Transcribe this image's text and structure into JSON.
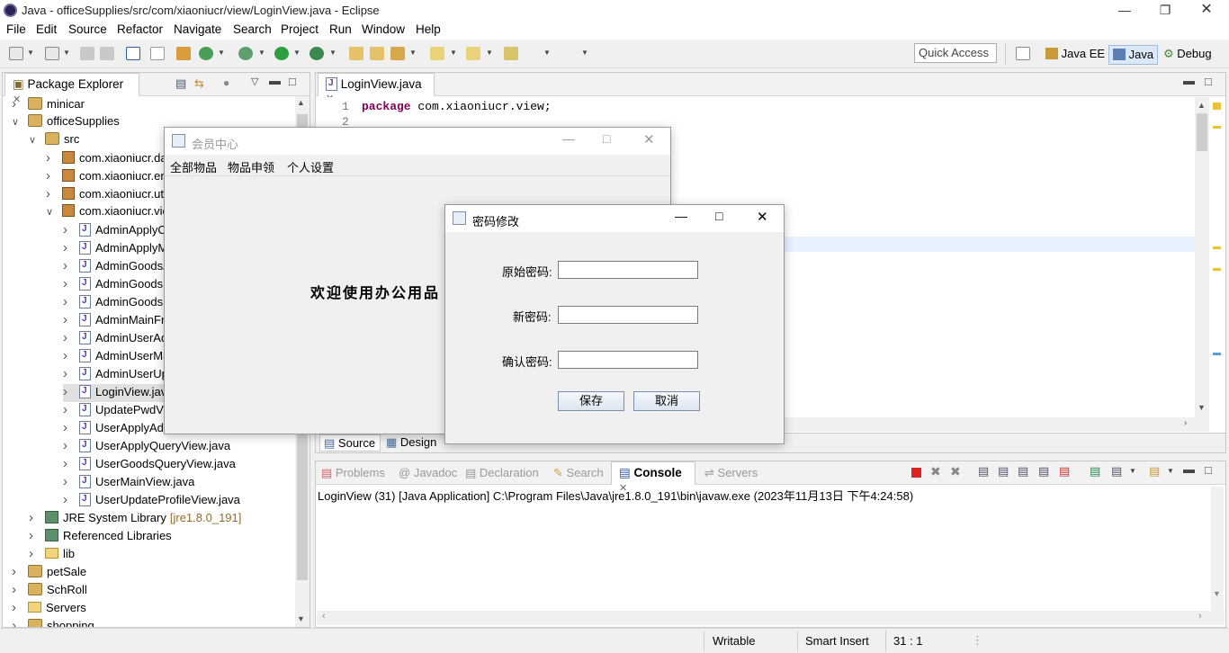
{
  "window": {
    "title": "Java - officeSupplies/src/com/xiaoniucr/view/LoginView.java - Eclipse"
  },
  "menubar": [
    "File",
    "Edit",
    "Source",
    "Refactor",
    "Navigate",
    "Search",
    "Project",
    "Run",
    "Window",
    "Help"
  ],
  "toolbar": {
    "quick_access": "Quick Access",
    "perspectives": [
      "Java EE",
      "Java",
      "Debug"
    ]
  },
  "package_explorer": {
    "tab_label": "Package Explorer",
    "rows": [
      {
        "label": "minicar",
        "icon": "project-icon",
        "arrow": ">"
      },
      {
        "label": "officeSupplies",
        "icon": "project-icon",
        "arrow": "v"
      },
      {
        "label": "src",
        "icon": "src-folder-icon",
        "arrow": "v"
      },
      {
        "label": "com.xiaoniucr.dao",
        "icon": "package-icon",
        "arrow": ">"
      },
      {
        "label": "com.xiaoniucr.entity",
        "icon": "package-icon",
        "arrow": ">"
      },
      {
        "label": "com.xiaoniucr.util",
        "icon": "package-icon",
        "arrow": ">"
      },
      {
        "label": "com.xiaoniucr.view",
        "icon": "package-icon",
        "arrow": "v"
      },
      {
        "label": "AdminApplyCheckView.java",
        "icon": "java-file-icon",
        "arrow": ">"
      },
      {
        "label": "AdminApplyManageView.java",
        "icon": "java-file-icon",
        "arrow": ">"
      },
      {
        "label": "AdminGoodsAddView.java",
        "icon": "java-file-icon",
        "arrow": ">"
      },
      {
        "label": "AdminGoodsManageView.java",
        "icon": "java-file-icon",
        "arrow": ">"
      },
      {
        "label": "AdminGoodsUpdateView.java",
        "icon": "java-file-icon",
        "arrow": ">"
      },
      {
        "label": "AdminMainFrame.java",
        "icon": "java-file-icon",
        "arrow": ">"
      },
      {
        "label": "AdminUserAddView.java",
        "icon": "java-file-icon",
        "arrow": ">"
      },
      {
        "label": "AdminUserManageView.java",
        "icon": "java-file-icon",
        "arrow": ">"
      },
      {
        "label": "AdminUserUpdateView.java",
        "icon": "java-file-icon",
        "arrow": ">"
      },
      {
        "label": "LoginView.java",
        "icon": "java-file-icon",
        "arrow": ">"
      },
      {
        "label": "UpdatePwdView.java",
        "icon": "java-file-icon",
        "arrow": ">"
      },
      {
        "label": "UserApplyAddView.java",
        "icon": "java-file-icon",
        "arrow": ">"
      },
      {
        "label": "UserApplyQueryView.java",
        "icon": "java-file-icon",
        "arrow": ">"
      },
      {
        "label": "UserGoodsQueryView.java",
        "icon": "java-file-icon",
        "arrow": ">"
      },
      {
        "label": "UserMainView.java",
        "icon": "java-file-icon",
        "arrow": ">"
      },
      {
        "label": "UserUpdateProfileView.java",
        "icon": "java-file-icon",
        "arrow": ">"
      },
      {
        "label": "JRE System Library",
        "suffix": "[jre1.8.0_191]",
        "icon": "library-icon",
        "arrow": ">"
      },
      {
        "label": "Referenced Libraries",
        "icon": "library-icon",
        "arrow": ">"
      },
      {
        "label": "lib",
        "icon": "folder-icon",
        "arrow": ">"
      },
      {
        "label": "petSale",
        "icon": "project-icon",
        "arrow": ">"
      },
      {
        "label": "SchRoll",
        "icon": "project-icon",
        "arrow": ">"
      },
      {
        "label": "Servers",
        "icon": "folder-icon",
        "arrow": ">"
      },
      {
        "label": "shopping",
        "icon": "project-icon",
        "arrow": ">"
      }
    ]
  },
  "editor": {
    "tab_label": "LoginView.java",
    "line_numbers": [
      "1",
      "2"
    ],
    "line1_keyword": "package",
    "line1_rest": " com.xiaoniucr.view;",
    "bottom_tabs": [
      "Source",
      "Design"
    ]
  },
  "console": {
    "tabs": [
      "Problems",
      "Javadoc",
      "Declaration",
      "Search",
      "Console",
      "Servers"
    ],
    "header_line": "LoginView (31) [Java Application] C:\\Program Files\\Java\\jre1.8.0_191\\bin\\javaw.exe (2023年11月13日 下午4:24:58)"
  },
  "member_window": {
    "title": "会员中心",
    "menu": [
      "全部物品",
      "物品申领",
      "个人设置"
    ],
    "welcome": "欢迎使用办公用品"
  },
  "password_dialog": {
    "title": "密码修改",
    "labels": [
      "原始密码:",
      "新密码:",
      "确认密码:"
    ],
    "save": "保存",
    "cancel": "取消"
  },
  "statusbar": {
    "writable": "Writable",
    "insert_mode": "Smart Insert",
    "position": "31 : 1"
  }
}
